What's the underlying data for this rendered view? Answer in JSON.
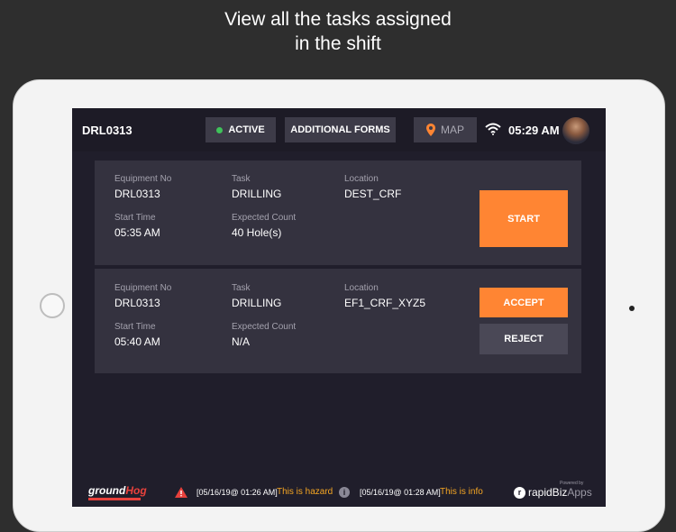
{
  "headline": {
    "line1": "View all the tasks assigned",
    "line2": "in the shift"
  },
  "topbar": {
    "equipment_id": "DRL0313",
    "status_label": "ACTIVE",
    "status_color": "#3fc25a",
    "forms_label": "ADDITIONAL FORMS",
    "map_label": "MAP",
    "time": "05:29 AM"
  },
  "tasks": [
    {
      "equipment_label": "Equipment No",
      "equipment_value": "DRL0313",
      "task_label": "Task",
      "task_value": "DRILLING",
      "location_label": "Location",
      "location_value": "DEST_CRF",
      "start_label": "Start Time",
      "start_value": "05:35 AM",
      "count_label": "Expected Count",
      "count_value": "40 Hole(s)",
      "start_button": "START"
    },
    {
      "equipment_label": "Equipment No",
      "equipment_value": "DRL0313",
      "task_label": "Task",
      "task_value": "DRILLING",
      "location_label": "Location",
      "location_value": "EF1_CRF_XYZ5",
      "start_label": "Start Time",
      "start_value": "05:40 AM",
      "count_label": "Expected Count",
      "count_value": "N/A",
      "accept_button": "ACCEPT",
      "reject_button": "REJECT"
    }
  ],
  "footer": {
    "logo_ground": "ground",
    "logo_hog": "Hog",
    "hazard_time": "[05/16/19@ 01:26 AM]",
    "hazard_msg": "This is hazard",
    "info_time": "[05/16/19@ 01:28 AM]",
    "info_msg": "This is info",
    "powered_by": "Powered by",
    "brand_rapid": "rapidBiz",
    "brand_apps": "Apps"
  },
  "colors": {
    "accent": "#ff8533",
    "background": "#201e2b",
    "card": "#34323f"
  }
}
